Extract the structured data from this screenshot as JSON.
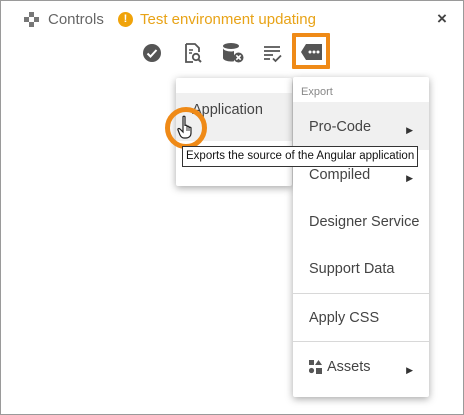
{
  "header": {
    "title": "Controls",
    "warning_text": "Test environment updating",
    "warning_symbol": "!",
    "close_symbol": "×"
  },
  "toolbar": {
    "icons": [
      "check-circle-icon",
      "document-search-icon",
      "database-delete-icon",
      "list-check-icon",
      "tag-more-icon"
    ]
  },
  "app_menu": {
    "items": [
      {
        "label": "Application"
      }
    ]
  },
  "export_menu": {
    "section_label": "Export",
    "items": [
      {
        "label": "Pro-Code",
        "has_submenu": true
      },
      {
        "label": "Compiled",
        "has_submenu": true
      },
      {
        "label": "Designer Service",
        "has_submenu": false
      },
      {
        "label": "Support Data",
        "has_submenu": false
      },
      {
        "label": "Apply CSS",
        "has_submenu": false
      },
      {
        "label": "Assets",
        "has_submenu": true
      }
    ],
    "submenu_arrow": "▶"
  },
  "tooltip": {
    "text": "Exports the source of the Angular application"
  },
  "colors": {
    "accent": "#ef8a17",
    "warning": "#e8a317"
  }
}
